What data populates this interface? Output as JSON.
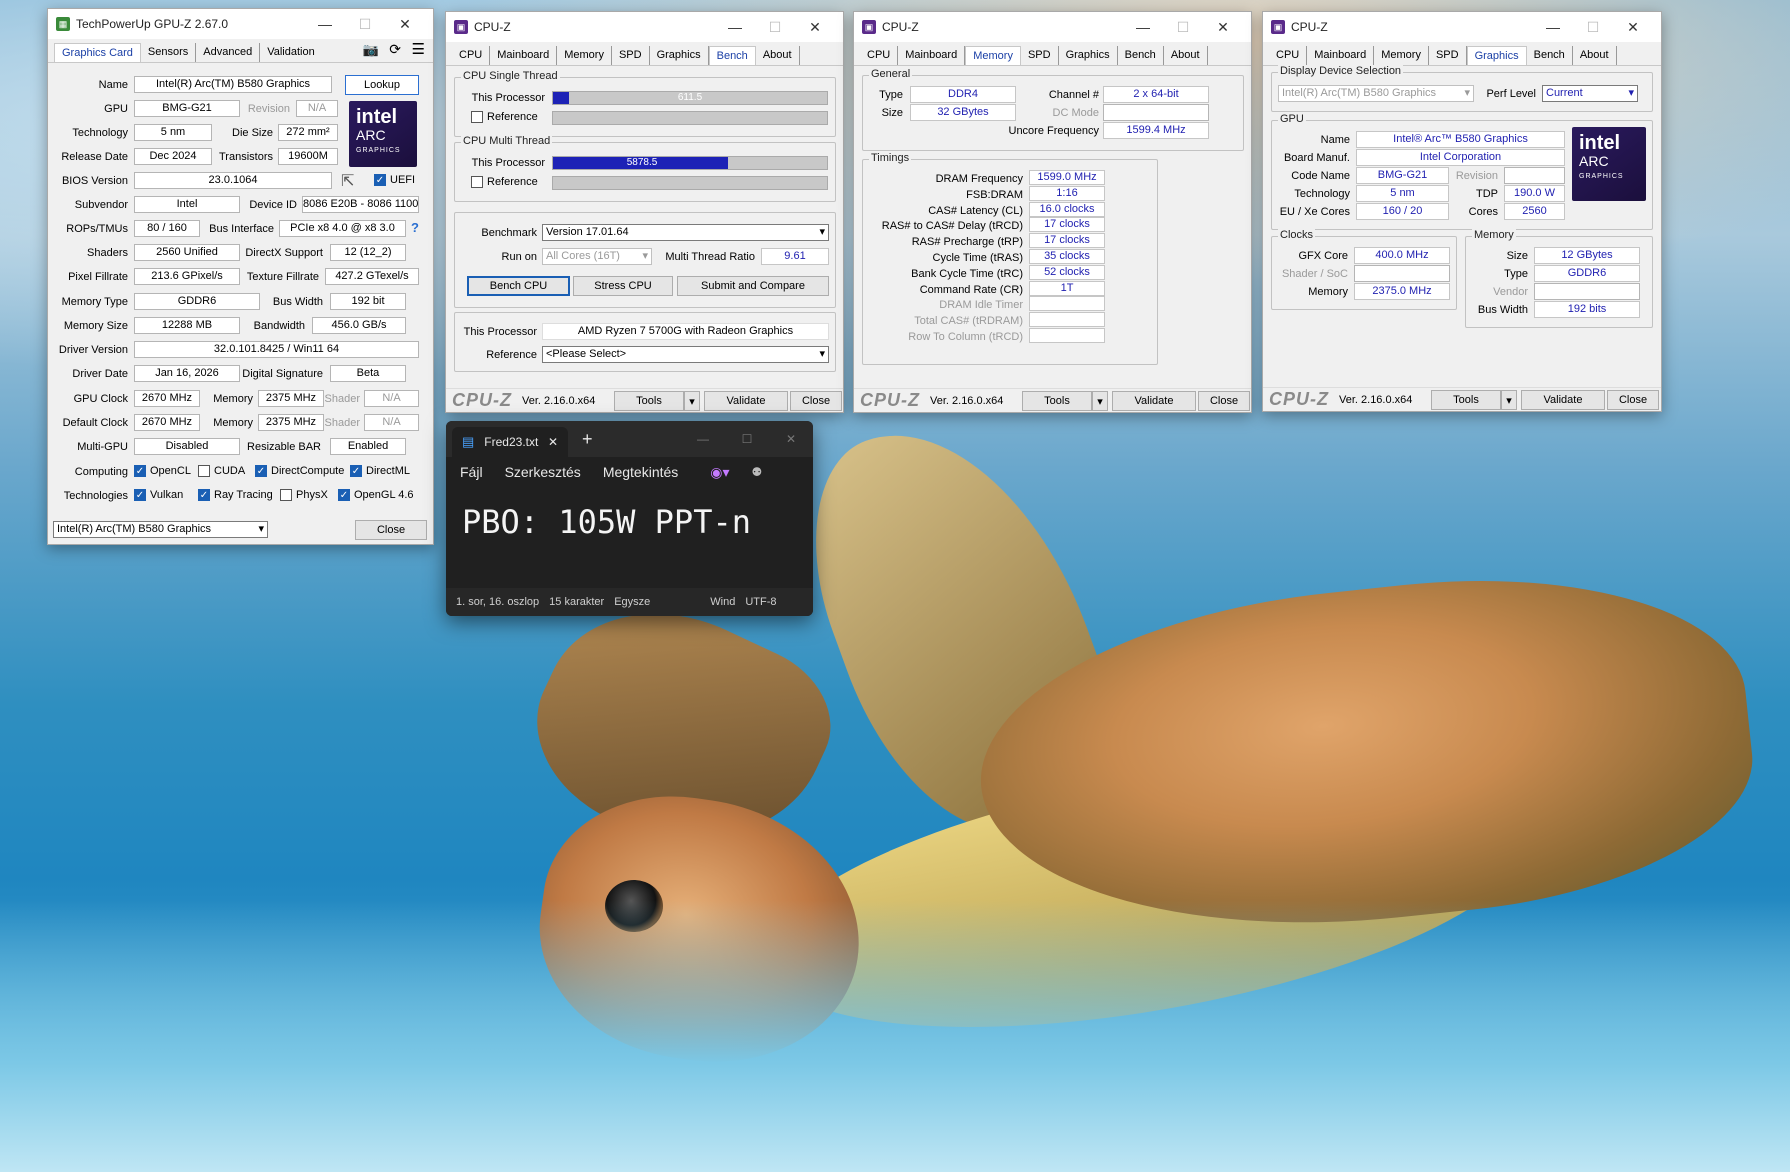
{
  "gpuz": {
    "title": "TechPowerUp GPU-Z 2.67.0",
    "tabs": [
      "Graphics Card",
      "Sensors",
      "Advanced",
      "Validation"
    ],
    "name_label": "Name",
    "name": "Intel(R) Arc(TM) B580 Graphics",
    "lookup": "Lookup",
    "gpu_label": "GPU",
    "gpu": "BMG-G21",
    "revision_label": "Revision",
    "revision": "N/A",
    "technology_label": "Technology",
    "technology": "5 nm",
    "die_size_label": "Die Size",
    "die_size": "272 mm²",
    "release_label": "Release Date",
    "release": "Dec 2024",
    "transistors_label": "Transistors",
    "transistors": "19600M",
    "bios_label": "BIOS Version",
    "bios": "23.0.1064",
    "uefi": "UEFI",
    "subvendor_label": "Subvendor",
    "subvendor": "Intel",
    "device_id_label": "Device ID",
    "device_id": "8086 E20B - 8086 1100",
    "rops_label": "ROPs/TMUs",
    "rops": "80 / 160",
    "bus_label": "Bus Interface",
    "bus": "PCIe x8 4.0 @ x8 3.0",
    "bus_help": "?",
    "shaders_label": "Shaders",
    "shaders": "2560 Unified",
    "directx_label": "DirectX Support",
    "directx": "12 (12_2)",
    "pixel_label": "Pixel Fillrate",
    "pixel": "213.6 GPixel/s",
    "texture_label": "Texture Fillrate",
    "texture": "427.2 GTexel/s",
    "memtype_label": "Memory Type",
    "memtype": "GDDR6",
    "buswidth_label": "Bus Width",
    "buswidth": "192 bit",
    "memsize_label": "Memory Size",
    "memsize": "12288 MB",
    "bandwidth_label": "Bandwidth",
    "bandwidth": "456.0 GB/s",
    "driver_label": "Driver Version",
    "driver": "32.0.101.8425 / Win11 64",
    "driverdate_label": "Driver Date",
    "driverdate": "Jan 16, 2026",
    "digsig_label": "Digital Signature",
    "digsig": "Beta",
    "gpuclock_label": "GPU Clock",
    "gpuclock": "2670 MHz",
    "memory_label": "Memory",
    "memclock": "2375 MHz",
    "shader_label": "Shader",
    "shader": "N/A",
    "defclock_label": "Default Clock",
    "defclock": "2670 MHz",
    "defmem": "2375 MHz",
    "defshader": "N/A",
    "multigpu_label": "Multi-GPU",
    "multigpu": "Disabled",
    "rebar_label": "Resizable BAR",
    "rebar": "Enabled",
    "computing_label": "Computing",
    "technologies_label": "Technologies",
    "computing": [
      {
        "label": "OpenCL",
        "on": true
      },
      {
        "label": "CUDA",
        "on": false
      },
      {
        "label": "DirectCompute",
        "on": true
      },
      {
        "label": "DirectML",
        "on": true
      }
    ],
    "techs": [
      {
        "label": "Vulkan",
        "on": true
      },
      {
        "label": "Ray Tracing",
        "on": true
      },
      {
        "label": "PhysX",
        "on": false
      },
      {
        "label": "OpenGL 4.6",
        "on": true
      }
    ],
    "selector": "Intel(R) Arc(TM) B580 Graphics",
    "close": "Close"
  },
  "logo": {
    "line1": "intel",
    "line2": "ARC",
    "line3": "GRAPHICS"
  },
  "cpuz_common": {
    "title": "CPU-Z",
    "brand": "CPU-Z",
    "version": "Ver. 2.16.0.x64",
    "tools": "Tools",
    "validate": "Validate",
    "close": "Close",
    "tabs": [
      "CPU",
      "Mainboard",
      "Memory",
      "SPD",
      "Graphics",
      "Bench",
      "About"
    ]
  },
  "bench": {
    "single_title": "CPU Single Thread",
    "this_processor": "This Processor",
    "reference": "Reference",
    "single_value": "611.5",
    "single_fraction": 0.06,
    "multi_title": "CPU Multi Thread",
    "multi_value": "5878.5",
    "multi_fraction": 0.64,
    "benchmark_label": "Benchmark",
    "benchmark": "Version 17.01.64",
    "runon_label": "Run on",
    "runon": "All Cores (16T)",
    "ratio_label": "Multi Thread Ratio",
    "ratio": "9.61",
    "bench_cpu": "Bench CPU",
    "stress_cpu": "Stress CPU",
    "submit": "Submit and Compare",
    "proc_label": "This Processor",
    "proc": "AMD Ryzen 7 5700G with Radeon Graphics",
    "ref_label": "Reference",
    "ref": "<Please Select>"
  },
  "memory": {
    "general_title": "General",
    "type_label": "Type",
    "type": "DDR4",
    "channel_label": "Channel #",
    "channel": "2 x 64-bit",
    "size_label": "Size",
    "size": "32 GBytes",
    "dc_label": "DC Mode",
    "uncore_label": "Uncore Frequency",
    "uncore": "1599.4 MHz",
    "timings_title": "Timings",
    "timings": [
      {
        "label": "DRAM Frequency",
        "value": "1599.0 MHz"
      },
      {
        "label": "FSB:DRAM",
        "value": "1:16"
      },
      {
        "label": "CAS# Latency (CL)",
        "value": "16.0 clocks"
      },
      {
        "label": "RAS# to CAS# Delay (tRCD)",
        "value": "17 clocks"
      },
      {
        "label": "RAS# Precharge (tRP)",
        "value": "17 clocks"
      },
      {
        "label": "Cycle Time (tRAS)",
        "value": "35 clocks"
      },
      {
        "label": "Bank Cycle Time (tRC)",
        "value": "52 clocks"
      },
      {
        "label": "Command Rate (CR)",
        "value": "1T"
      },
      {
        "label": "DRAM Idle Timer",
        "value": ""
      },
      {
        "label": "Total CAS# (tRDRAM)",
        "value": ""
      },
      {
        "label": "Row To Column (tRCD)",
        "value": ""
      }
    ]
  },
  "graphics": {
    "display_title": "Display Device Selection",
    "device": "Intel(R) Arc(TM) B580 Graphics",
    "perf_label": "Perf Level",
    "perf": "Current",
    "gpu_title": "GPU",
    "name_label": "Name",
    "name": "Intel® Arc™ B580 Graphics",
    "board_label": "Board Manuf.",
    "board": "Intel Corporation",
    "code_label": "Code Name",
    "code": "BMG-G21",
    "revision_label": "Revision",
    "tech_label": "Technology",
    "tech": "5 nm",
    "tdp_label": "TDP",
    "tdp": "190.0 W",
    "eu_label": "EU / Xe Cores",
    "eu": "160 / 20",
    "cores_label": "Cores",
    "cores": "2560",
    "clocks_title": "Clocks",
    "gfx_label": "GFX Core",
    "gfx": "400.0 MHz",
    "shader_label": "Shader / SoC",
    "memory_label": "Memory",
    "memclock": "2375.0 MHz",
    "mem_title": "Memory",
    "size_label": "Size",
    "size": "12 GBytes",
    "type_label": "Type",
    "type": "GDDR6",
    "vendor_label": "Vendor",
    "buswidth_label": "Bus Width",
    "buswidth": "192 bits"
  },
  "notepad": {
    "tab": "Fred23.txt",
    "close_tab": "✕",
    "new_tab": "+",
    "menu": [
      "Fájl",
      "Szerkesztés",
      "Megtekintés"
    ],
    "content": "PBO: 105W PPT-n",
    "status": [
      "1. sor, 16. oszlop",
      "15 karakter",
      "Egysze",
      "Wind",
      "UTF-8"
    ]
  }
}
